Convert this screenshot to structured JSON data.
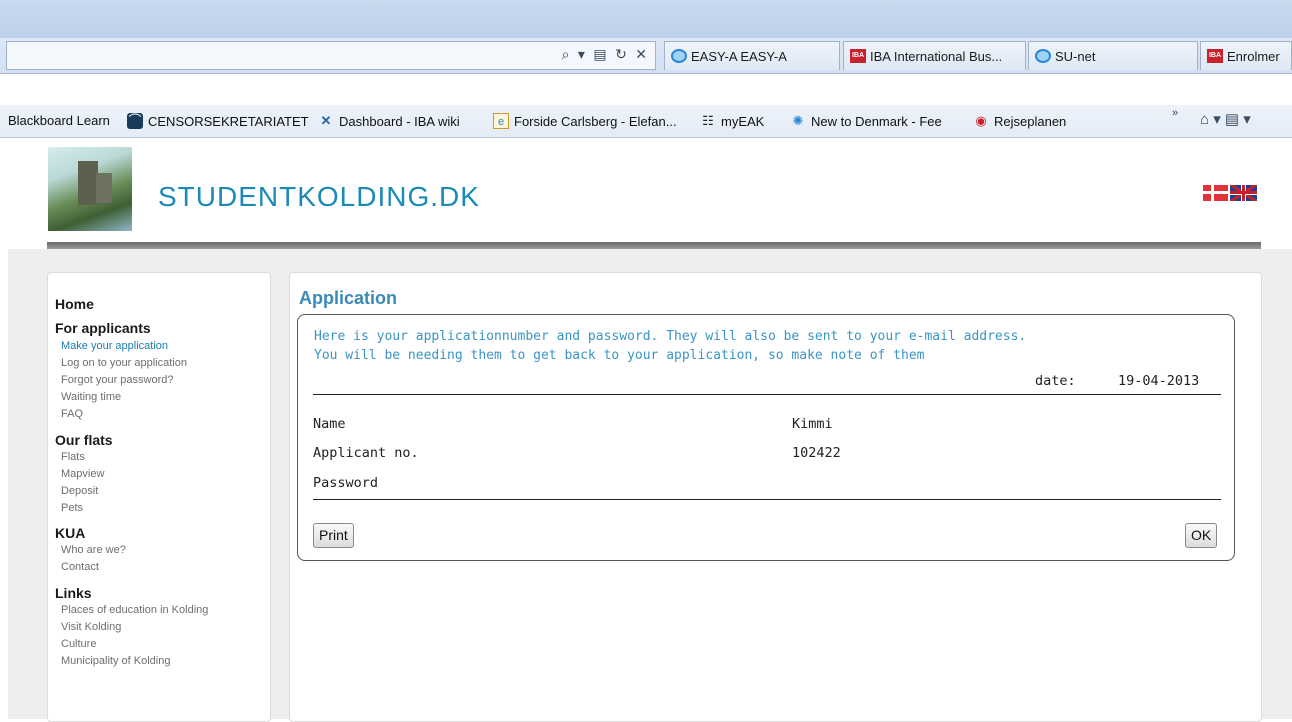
{
  "browser": {
    "tabs": [
      {
        "label": "EASY-A EASY-A",
        "icon": "ie-icon"
      },
      {
        "label": "IBA International Bus...",
        "icon": "iba-icon"
      },
      {
        "label": "SU-net",
        "icon": "ie-icon"
      },
      {
        "label": "Enrolmer",
        "icon": "iba-icon"
      }
    ],
    "address_tools": "⌕ ▾ ▤ ↻ ✕",
    "favorites": [
      {
        "label": "Blackboard Learn",
        "icon": ""
      },
      {
        "label": "CENSORSEKRETARIATET",
        "icon": "censor-icon"
      },
      {
        "label": "Dashboard - IBA wiki",
        "icon": "confluence-icon"
      },
      {
        "label": "Forside  Carlsberg - Elefan...",
        "icon": "ie-page-icon"
      },
      {
        "label": "myEAK",
        "icon": "grid-icon"
      },
      {
        "label": "New to Denmark - Fee",
        "icon": "sun-icon"
      },
      {
        "label": "Rejseplanen",
        "icon": "target-icon"
      }
    ],
    "chevron": "»",
    "home_tools": "⌂ ▾  ▤ ▾"
  },
  "site": {
    "title": "STUDENTKOLDING.DK"
  },
  "sidebar": {
    "sections": [
      {
        "heading": "Home",
        "links": []
      },
      {
        "heading": "For applicants",
        "links": [
          "Make your application",
          "Log on to your application",
          "Forgot your password?",
          "Waiting time",
          "FAQ"
        ]
      },
      {
        "heading": "Our flats",
        "links": [
          "Flats",
          "Mapview",
          "Deposit",
          "Pets"
        ]
      },
      {
        "heading": "KUA",
        "links": [
          "Who are we?",
          "Contact"
        ]
      },
      {
        "heading": "Links",
        "links": [
          "Places of education in Kolding",
          "Visit Kolding",
          "Culture",
          "Municipality of Kolding"
        ]
      }
    ],
    "active_link": "Make your application"
  },
  "main": {
    "title": "Application",
    "message_line1": "Here is your applicationnumber and password. They will also be sent to your e-mail address.",
    "message_line2": "You will be needing them to get back to your application, so make note of them",
    "date_label": "date:",
    "date_value": "19-04-2013",
    "fields": [
      {
        "label": "Name",
        "value": "Kimmi"
      },
      {
        "label": "Applicant no.",
        "value": "102422"
      },
      {
        "label": "Password",
        "value": ""
      }
    ],
    "print_label": "Print",
    "ok_label": "OK"
  },
  "colors": {
    "accent": "#1c8ab7",
    "link_active": "#1a7fb0",
    "message": "#3a95c5"
  }
}
